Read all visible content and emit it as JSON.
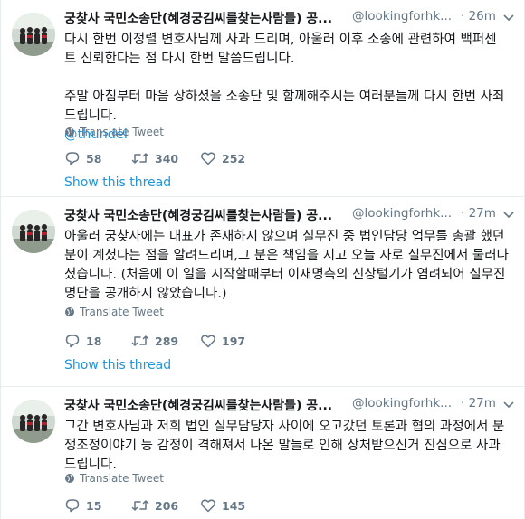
{
  "tweets": [
    {
      "name": "궁찾사 국민소송단(혜경궁김씨를찾는사람들) 공...",
      "handle": "@lookingforhk...",
      "time": "· 26m",
      "lines": [
        "다시 한번 이정렬 변호사님께 사과 드리며, 아울러 이후 소송에 관련하여 백퍼센",
        "트 신뢰한다는 점 다시 한번 말씀드립니다."
      ],
      "lines2": [
        "주말 아침부터 마음 상하셨을 소송단 및 함께해주시는 여러분들께 다시 한번 사죄",
        "드립니다."
      ],
      "mention": "@thundel",
      "translate": "Translate Tweet",
      "replies": "58",
      "retweets": "340",
      "likes": "252",
      "show_thread": "Show this thread"
    },
    {
      "name": "궁찾사 국민소송단(혜경궁김씨를찾는사람들) 공...",
      "handle": "@lookingforhk...",
      "time": "· 27m",
      "lines": [
        "아울러 궁찾사에는 대표가 존재하지 않으며 실무진 중 법인담당 업무를 총괄 했던",
        "분이 계셨다는 점을 알려드리며,그 분은 책임을 지고 오늘 자로 실무진에서 물러나",
        "셨습니다. (처음에 이 일을 시작할때부터 이재명측의 신상털기가 염려되어 실무진",
        "명단을 공개하지 않았습니다.)"
      ],
      "translate": "Translate Tweet",
      "replies": "18",
      "retweets": "289",
      "likes": "197",
      "show_thread": "Show this thread"
    },
    {
      "name": "궁찾사 국민소송단(혜경궁김씨를찾는사람들) 공...",
      "handle": "@lookingforhk...",
      "time": "· 27m",
      "lines": [
        "그간 변호사님과 저희 법인 실무담당자 사이에 오고갔던 토론과 협의 과정에서 분",
        "쟁조정이야기 등 감정이 격해져서 나온 말들로 인해 상처받으신거 진심으로 사과",
        "드립니다."
      ],
      "translate": "Translate Tweet",
      "replies": "15",
      "retweets": "206",
      "likes": "145"
    }
  ],
  "colors": {
    "text": "#14171a",
    "secondary": "#657786",
    "link": "#1b95e0",
    "border": "#e6ecf0"
  },
  "icons": [
    "avatar-image",
    "caret-down-icon",
    "globe-icon",
    "reply-icon",
    "retweet-icon",
    "like-icon"
  ]
}
